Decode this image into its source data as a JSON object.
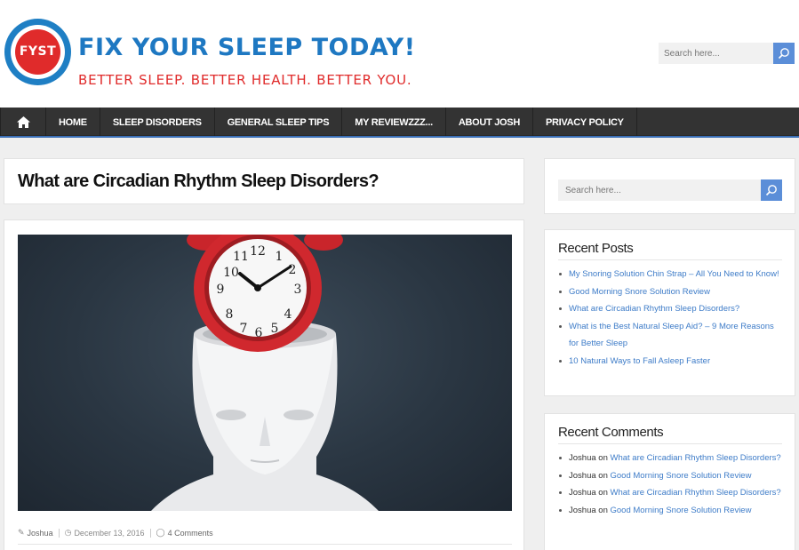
{
  "header": {
    "logo_text": "FYST",
    "site_title": "FIX YOUR SLEEP TODAY!",
    "tagline": "BETTER SLEEP. BETTER HEALTH. BETTER YOU.",
    "search_placeholder": "Search here..."
  },
  "nav": {
    "home_icon": "home-icon",
    "items": [
      {
        "label": "HOME"
      },
      {
        "label": "SLEEP DISORDERS"
      },
      {
        "label": "GENERAL SLEEP TIPS"
      },
      {
        "label": "MY REVIEWZZZ..."
      },
      {
        "label": "ABOUT JOSH"
      },
      {
        "label": "PRIVACY POLICY"
      }
    ]
  },
  "post": {
    "title": "What are Circadian Rhythm Sleep Disorders?",
    "author": "Joshua",
    "date": "December 13, 2016",
    "comments": "4 Comments"
  },
  "sidebar": {
    "search_placeholder": "Search here...",
    "recent_posts": {
      "title": "Recent Posts",
      "items": [
        {
          "label": "My Snoring Solution Chin Strap – All You Need to Know!"
        },
        {
          "label": "Good Morning Snore Solution Review"
        },
        {
          "label": "What are Circadian Rhythm Sleep Disorders?"
        },
        {
          "label": "What is the Best Natural Sleep Aid? – 9 More Reasons for Better Sleep"
        },
        {
          "label": "10 Natural Ways to Fall Asleep Faster"
        }
      ]
    },
    "recent_comments": {
      "title": "Recent Comments",
      "items": [
        {
          "author": "Joshua",
          "on": "on",
          "post": "What are Circadian Rhythm Sleep Disorders?"
        },
        {
          "author": "Joshua",
          "on": "on",
          "post": "Good Morning Snore Solution Review"
        },
        {
          "author": "Joshua",
          "on": "on",
          "post": "What are Circadian Rhythm Sleep Disorders?"
        },
        {
          "author": "Joshua",
          "on": "on",
          "post": "Good Morning Snore Solution Review"
        }
      ]
    }
  },
  "colors": {
    "brand_blue": "#1e78c2",
    "brand_red": "#e02b2b",
    "nav_bg": "#333333",
    "link": "#3e7cc8",
    "search_button": "#5b8ed8"
  }
}
